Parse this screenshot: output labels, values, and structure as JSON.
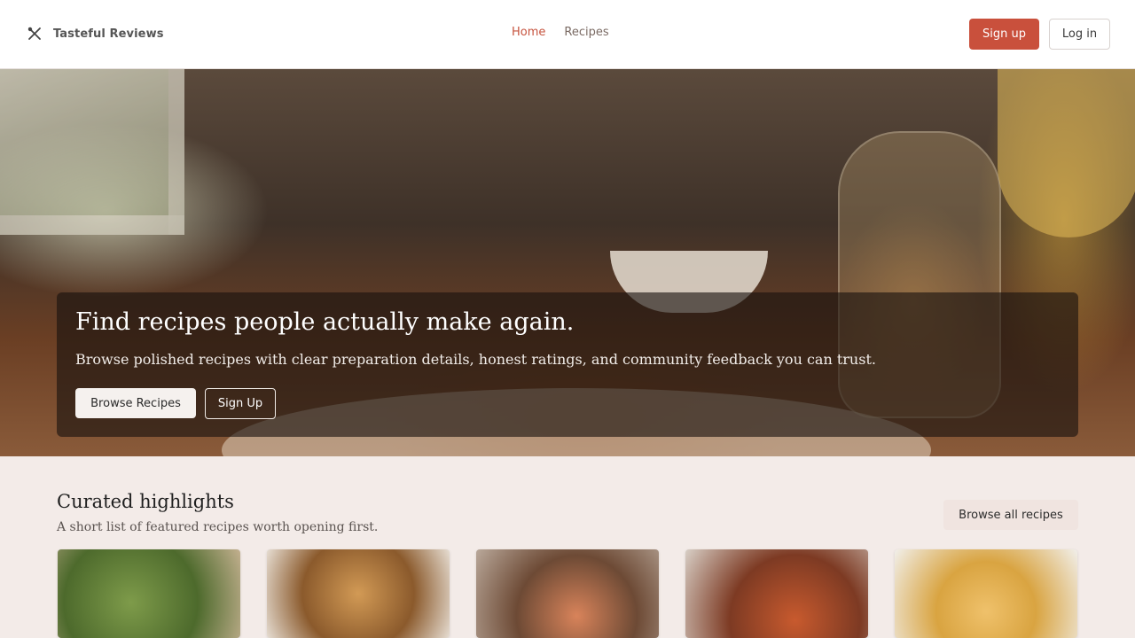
{
  "header": {
    "brand_name": "Tasteful Reviews",
    "brand_icon": "utensils-crossed-icon",
    "nav": [
      {
        "label": "Home",
        "active": true
      },
      {
        "label": "Recipes",
        "active": false
      }
    ],
    "signup_label": "Sign up",
    "login_label": "Log in"
  },
  "hero": {
    "title": "Find recipes people actually make again.",
    "subtitle": "Browse polished recipes with clear preparation details, honest ratings, and community feedback you can trust.",
    "browse_label": "Browse Recipes",
    "signup_label": "Sign Up"
  },
  "highlights": {
    "title": "Curated highlights",
    "subtitle": "A short list of featured recipes worth opening first.",
    "browse_all_label": "Browse all recipes",
    "cards": [
      {
        "image": "lettuce-wraps-photo"
      },
      {
        "image": "chocolate-chip-cookies-photo"
      },
      {
        "image": "salmon-bowl-photo"
      },
      {
        "image": "tomato-soup-photo"
      },
      {
        "image": "pancakes-photo"
      }
    ]
  },
  "colors": {
    "accent": "#c9503c",
    "nav_active": "#c6533e",
    "page_background": "#f3ebe8"
  }
}
